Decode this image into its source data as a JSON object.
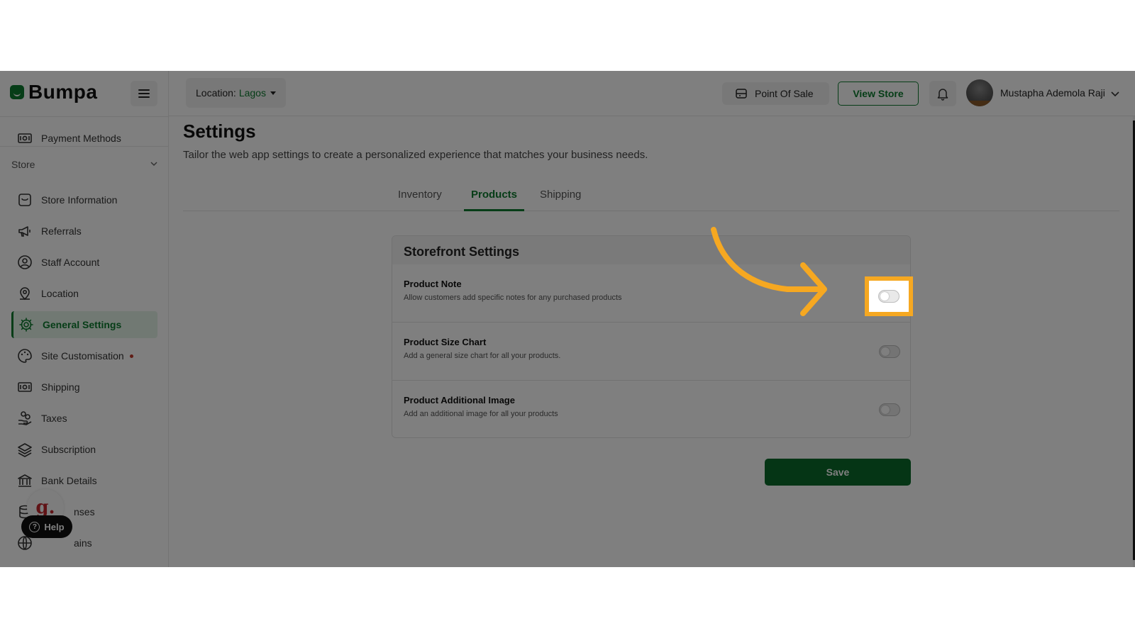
{
  "brand": {
    "name": "Bumpa"
  },
  "header": {
    "location_prefix": "Location:",
    "location_value": "Lagos",
    "pos_label": "Point Of Sale",
    "view_store_label": "View Store",
    "user_name": "Mustapha Ademola Raji"
  },
  "sidebar": {
    "top_item": "Payment Methods",
    "section_label": "Store",
    "items": [
      {
        "label": "Store Information",
        "icon": "storefront-icon"
      },
      {
        "label": "Referrals",
        "icon": "megaphone-icon"
      },
      {
        "label": "Staff Account",
        "icon": "user-circle-icon"
      },
      {
        "label": "Location",
        "icon": "location-pin-icon"
      },
      {
        "label": "General Settings",
        "icon": "gear-icon",
        "active": true
      },
      {
        "label": "Site Customisation",
        "icon": "palette-icon",
        "badge": "dot"
      },
      {
        "label": "Shipping",
        "icon": "money-icon"
      },
      {
        "label": "Taxes",
        "icon": "hand-coins-icon"
      },
      {
        "label": "Subscription",
        "icon": "layers-icon"
      },
      {
        "label": "Bank Details",
        "icon": "bank-icon"
      },
      {
        "label": "nses",
        "icon": "database-icon"
      },
      {
        "label": "ains",
        "icon": "globe-icon"
      }
    ],
    "g_badge": "g.",
    "help_label": "Help"
  },
  "page": {
    "title": "Settings",
    "subtitle": "Tailor the web app settings to create a personalized experience that matches your business needs.",
    "tabs": [
      {
        "label": "Inventory",
        "active": false
      },
      {
        "label": "Products",
        "active": true
      },
      {
        "label": "Shipping",
        "active": false
      }
    ]
  },
  "storefront": {
    "title": "Storefront Settings",
    "settings": [
      {
        "title": "Product Note",
        "desc": "Allow customers add specific notes for any purchased products",
        "enabled": false,
        "highlighted": true
      },
      {
        "title": "Product Size Chart",
        "desc": "Add a general size chart for all your products.",
        "enabled": false
      },
      {
        "title": "Product Additional Image",
        "desc": "Add an additional image for all your products",
        "enabled": false
      }
    ],
    "save_label": "Save"
  },
  "colors": {
    "brand_green": "#0d7a2f",
    "highlight": "#f6a821"
  }
}
